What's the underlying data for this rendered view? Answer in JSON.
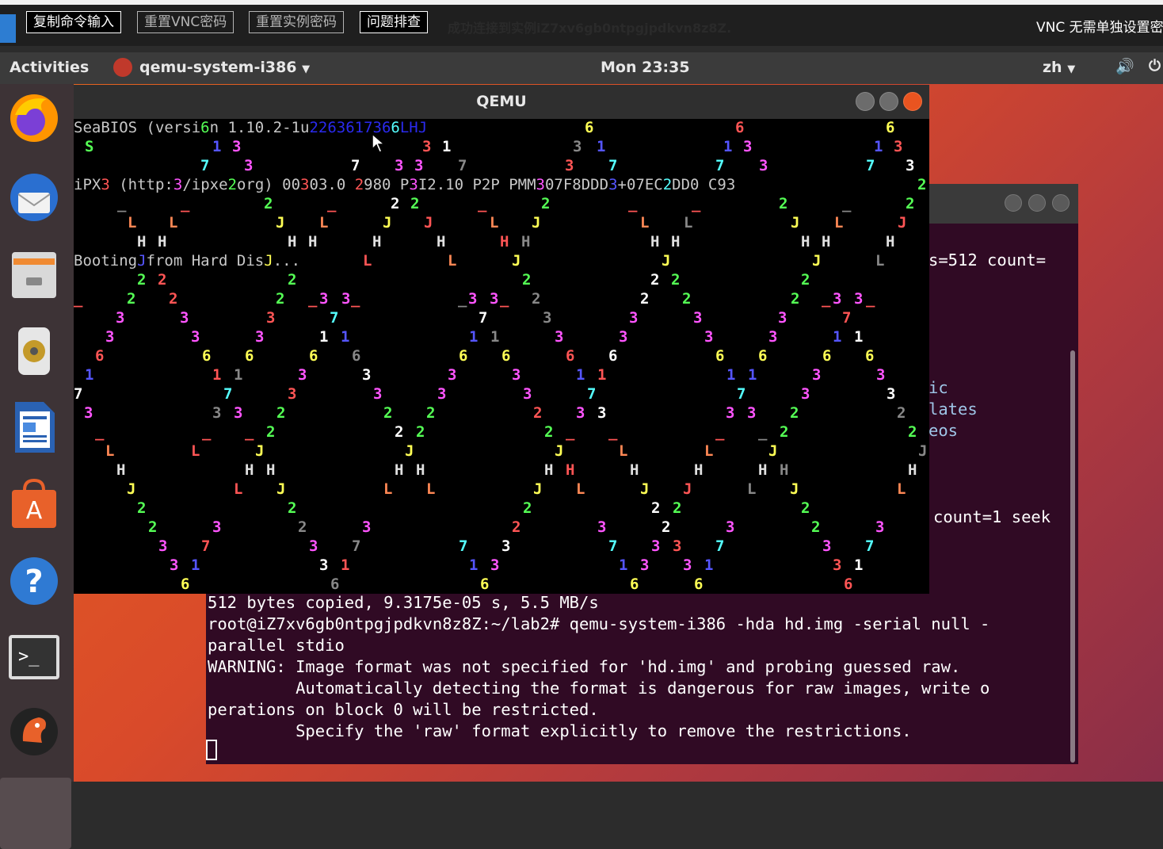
{
  "vnc_toolbar": {
    "buttons": [
      "复制命令输入",
      "重置VNC密码",
      "重置实例密码",
      "问题排查"
    ],
    "status": "成功连接到实例iZ7xv6gb0ntpgjpdkvn8z8Z.",
    "right_text": "VNC 无需单独设置密"
  },
  "topbar": {
    "activities": "Activities",
    "app_menu": "qemu-system-i386",
    "clock": "Mon 23:35",
    "input_method": "zh"
  },
  "dock": {
    "items": [
      "firefox-icon",
      "thunderbird-icon",
      "files-icon",
      "rhythmbox-icon",
      "libreoffice-writer-icon",
      "software-center-icon",
      "help-icon",
      "terminal-icon",
      "qemu-icon"
    ]
  },
  "qemu": {
    "title": "QEMU",
    "screen": {
      "line1_a": "SeaBIOS (versi",
      "line1_b": "n 1.10.2-1u",
      "line1_c": "LHJ",
      "line3_a": "iPX",
      "line3_b": " (http:",
      "line3_c": "/ipxe",
      "line3_d": "org) 00",
      "line3_e": "03.0 ",
      "line3_f": "980 P",
      "line3_g": "I2.10 P2P PMM",
      "line3_h": "07F8DDD",
      "line3_i": "+07EC",
      "line3_j": "DD0 C9",
      "line3_k": "3",
      "line6_a": "Booting",
      "line6_b": "from Hard Dis",
      "line6_c": "..."
    }
  },
  "terminal": {
    "partial_lines": [
      {
        "text": "s=512 count=",
        "row": 0
      },
      {
        "text": "ic",
        "row": 1
      },
      {
        "text": "lates",
        "row": 2
      },
      {
        "text": "eos",
        "row": 3
      },
      {
        "text": "count=1 seek",
        "row": 4
      }
    ],
    "lines": [
      "512 bytes copied, 9.3175e-05 s, 5.5 MB/s",
      "root@iZ7xv6gb0ntpgjpdkvn8z8Z:~/lab2# qemu-system-i386 -hda hd.img -serial null -",
      "parallel stdio",
      "WARNING: Image format was not specified for 'hd.img' and probing guessed raw.",
      "         Automatically detecting the format is dangerous for raw images, write o",
      "perations on block 0 will be restricted.",
      "         Specify the 'raw' format explicitly to remove the restrictions."
    ]
  },
  "glyph_colors": {
    "1": "#5555ff",
    "2": "#55ff55",
    "3": "#ff55ff",
    "6": "#ffff55",
    "7": "#55ffff",
    "L": "#ff8855",
    "H": "#e0e0e0",
    "J": "#ffff55",
    "S": "#55ff55",
    "_": "#ff5555"
  }
}
